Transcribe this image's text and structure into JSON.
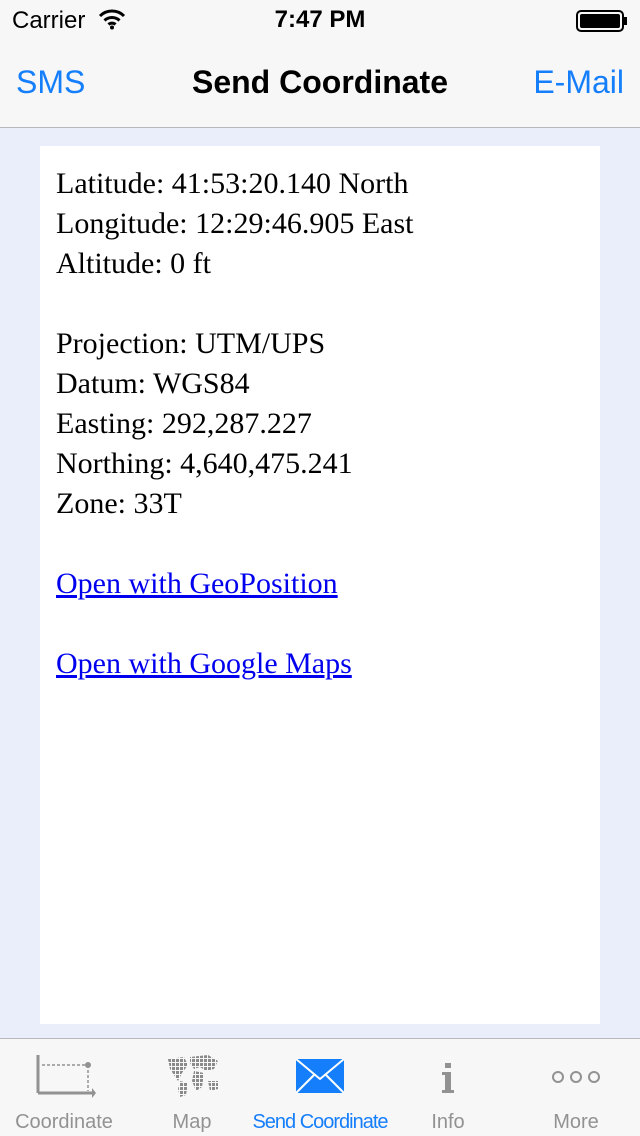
{
  "status": {
    "carrier": "Carrier",
    "time": "7:47 PM"
  },
  "nav": {
    "left_label": "SMS",
    "title": "Send Coordinate",
    "right_label": "E-Mail"
  },
  "coordinate": {
    "latitude": "Latitude: 41:53:20.140 North",
    "longitude": "Longitude: 12:29:46.905 East",
    "altitude": "Altitude: 0 ft",
    "projection": "Projection: UTM/UPS",
    "datum": "Datum: WGS84",
    "easting": "Easting: 292,287.227",
    "northing": "Northing: 4,640,475.241",
    "zone": "Zone: 33T"
  },
  "links": {
    "geoposition": "Open with GeoPosition",
    "google_maps": "Open with Google Maps"
  },
  "tabs": [
    {
      "label": "Coordinate",
      "icon": "coordinate-axes-icon"
    },
    {
      "label": "Map",
      "icon": "world-map-icon"
    },
    {
      "label": "Send Coordinate",
      "icon": "envelope-icon",
      "active": true
    },
    {
      "label": "Info",
      "icon": "info-icon"
    },
    {
      "label": "More",
      "icon": "more-dots-icon"
    }
  ],
  "colors": {
    "accent": "#157efb",
    "tab_inactive": "#929292",
    "link": "#0000ee",
    "background": "#e9eefa"
  }
}
